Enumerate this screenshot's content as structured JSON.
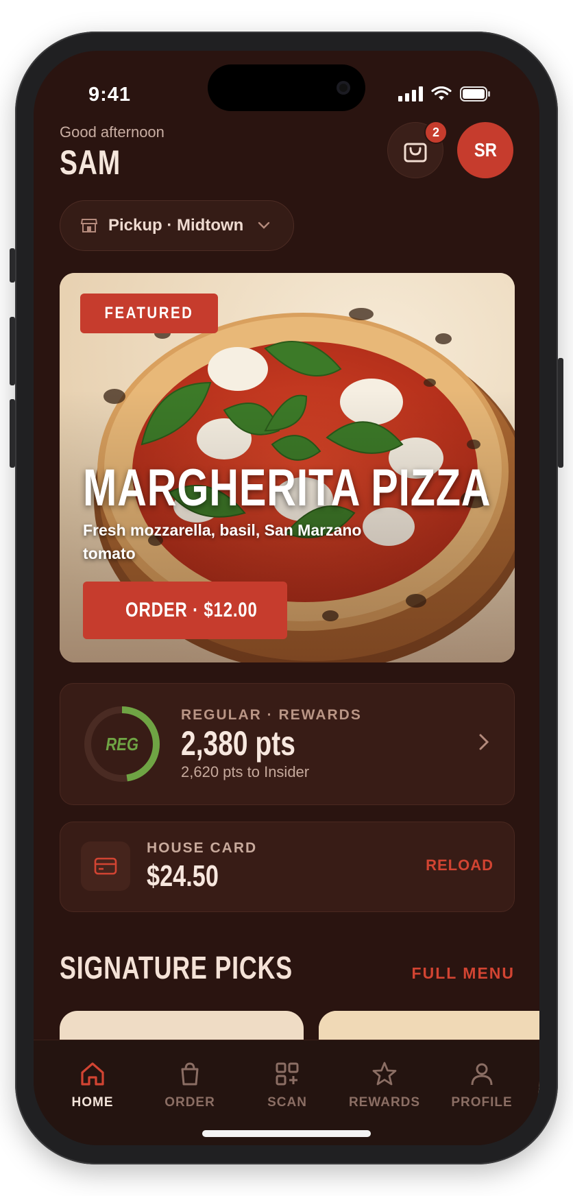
{
  "status_bar": {
    "time": "9:41"
  },
  "header": {
    "greeting": "Good afternoon",
    "user_name": "SAM",
    "cart_count": "2",
    "avatar_initials": "SR"
  },
  "location": {
    "label": "Pickup · Midtown"
  },
  "featured": {
    "badge": "FEATURED",
    "title": "MARGHERITA PIZZA",
    "description": "Fresh mozzarella, basil, San Marzano tomato",
    "order_button": "ORDER · $12.00"
  },
  "rewards": {
    "tier_badge": "REG",
    "tier_label": "REGULAR · REWARDS",
    "points": "2,380 pts",
    "next_tier_text": "2,620 pts to Insider",
    "progress": 0.476
  },
  "house_card": {
    "label": "HOUSE CARD",
    "balance": "$24.50",
    "action": "RELOAD"
  },
  "signature": {
    "title": "SIGNATURE PICKS",
    "link": "FULL MENU"
  },
  "tabs": [
    {
      "label": "HOME",
      "icon": "home-icon",
      "active": true
    },
    {
      "label": "ORDER",
      "icon": "bag-icon",
      "active": false
    },
    {
      "label": "SCAN",
      "icon": "scan-icon",
      "active": false
    },
    {
      "label": "REWARDS",
      "icon": "star-icon",
      "active": false
    },
    {
      "label": "PROFILE",
      "icon": "person-icon",
      "active": false
    }
  ],
  "colors": {
    "background": "#2a1410",
    "accent": "#c63c2d",
    "card": "#381c16",
    "reward_green": "#6fa444"
  }
}
